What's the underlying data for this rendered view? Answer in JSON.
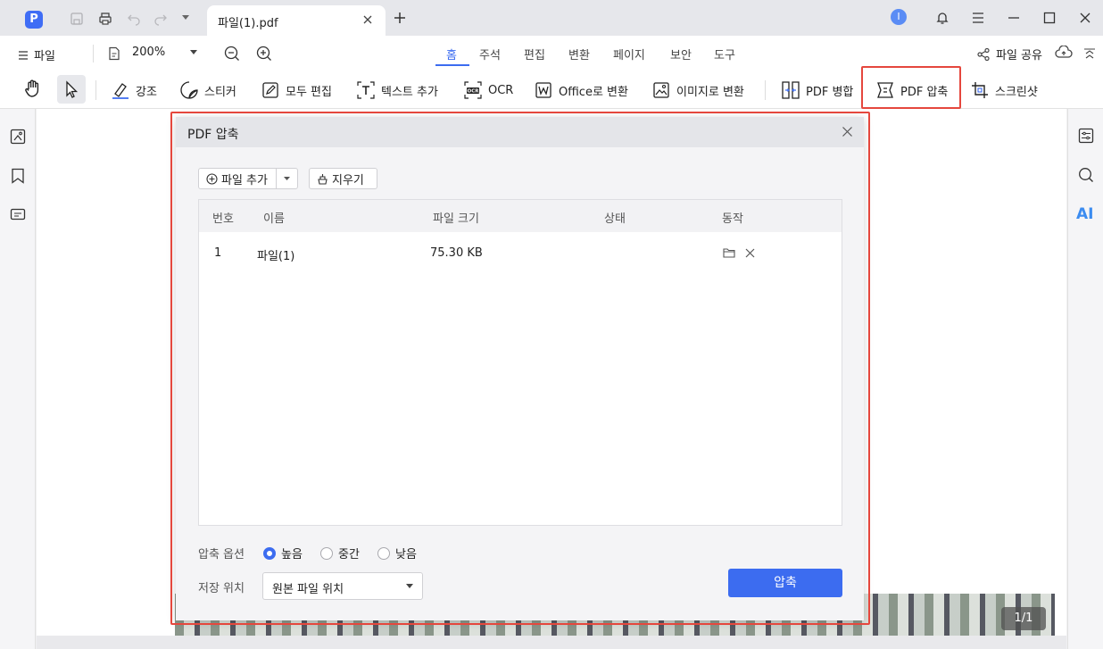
{
  "colors": {
    "accent": "#3c6cf0",
    "highlight_border": "#e5473d"
  },
  "titlebar": {
    "tab_title": "파일(1).pdf",
    "avatar_letter": "I"
  },
  "menubar": {
    "file_label": "파일",
    "zoom": "200%",
    "tabs": [
      "홈",
      "주석",
      "편집",
      "변환",
      "페이지",
      "보안",
      "도구"
    ],
    "active_tab": "홈",
    "share_label": "파일 공유"
  },
  "toolbar": {
    "highlight": "강조",
    "sticker": "스티커",
    "edit_all": "모두 편집",
    "add_text": "텍스트 추가",
    "ocr": "OCR",
    "to_office": "Office로 변환",
    "to_image": "이미지로 변환",
    "merge": "PDF 병합",
    "compress": "PDF 압축",
    "screenshot": "스크린샷"
  },
  "dialog": {
    "title": "PDF 압축",
    "add_file": "파일 추가",
    "clear": "지우기",
    "columns": [
      "번호",
      "이름",
      "파일 크기",
      "상태",
      "동작"
    ],
    "rows": [
      {
        "no": "1",
        "name": "파일(1)",
        "size": "75.30 KB",
        "status": ""
      }
    ],
    "compress_option_label": "압축 옵션",
    "options": [
      "높음",
      "중간",
      "낮음"
    ],
    "selected_option": "높음",
    "save_location_label": "저장 위치",
    "save_location_value": "원본 파일 위치",
    "compress_button": "압축"
  },
  "viewer": {
    "page_counter": "1/1"
  },
  "right_sidebar": {
    "ai_label": "AI"
  }
}
